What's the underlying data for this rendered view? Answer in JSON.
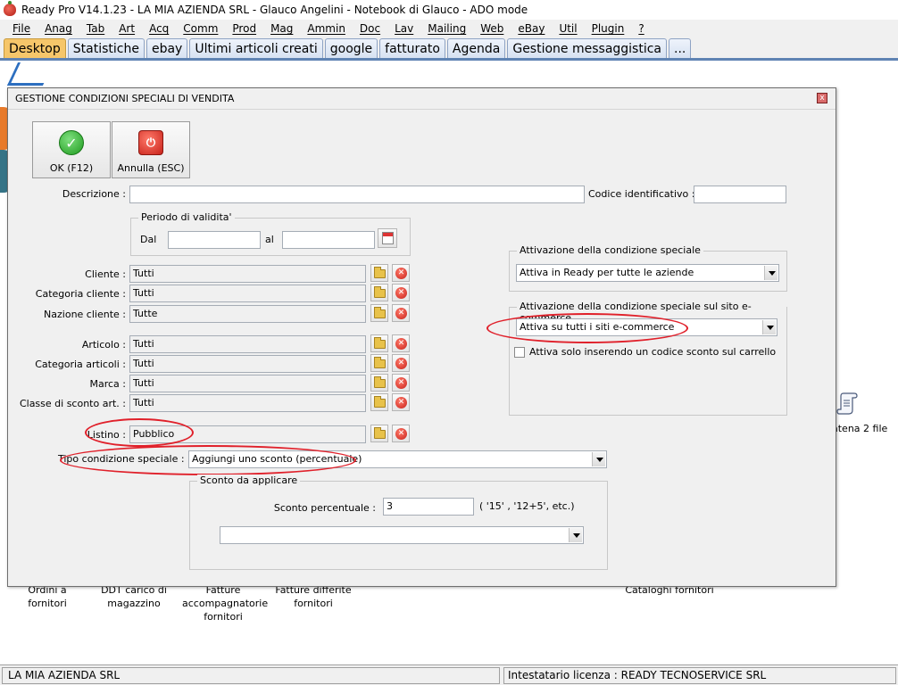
{
  "window": {
    "title": "Ready Pro V14.1.23 - LA MIA AZIENDA SRL - Glauco Angelini - Notebook di Glauco - ADO mode"
  },
  "menu": [
    "File",
    "Anag",
    "Tab",
    "Art",
    "Acq",
    "Comm",
    "Prod",
    "Mag",
    "Ammin",
    "Doc",
    "Lav",
    "Mailing",
    "Web",
    "eBay",
    "Util",
    "Plugin",
    "?"
  ],
  "tabs": [
    "Desktop",
    "Statistiche",
    "ebay",
    "Ultimi articoli creati",
    "google",
    "fatturato",
    "Agenda",
    "Gestione messaggistica",
    "..."
  ],
  "desktop": {
    "labels": {
      "ordini": "Ordini a fornitori",
      "ddt": "DDT carico di magazzino",
      "fatture_acc": "Fatture accompagnatorie fornitori",
      "fatture_diff": "Fatture differite fornitori",
      "cataloghi": "Cataloghi fornitori",
      "catena": "atena 2 file"
    }
  },
  "dialog": {
    "title": "GESTIONE CONDIZIONI SPECIALI DI VENDITA",
    "close": "x",
    "ok_label": "OK (F12)",
    "cancel_label": "Annulla (ESC)",
    "descrizione_label": "Descrizione :",
    "descrizione_value": "",
    "codice_label": "Codice identificativo :",
    "codice_value": "",
    "periodo": {
      "title": "Periodo di validita'",
      "dal_label": "Dal",
      "al_label": "al",
      "dal_value": "",
      "al_value": ""
    },
    "cliente": [
      {
        "label": "Cliente :",
        "value": "Tutti"
      },
      {
        "label": "Categoria cliente :",
        "value": "Tutti"
      },
      {
        "label": "Nazione cliente :",
        "value": "Tutte"
      }
    ],
    "articolo": [
      {
        "label": "Articolo :",
        "value": "Tutti"
      },
      {
        "label": "Categoria articoli :",
        "value": "Tutti"
      },
      {
        "label": "Marca :",
        "value": "Tutti"
      },
      {
        "label": "Classe di sconto art. :",
        "value": "Tutti"
      }
    ],
    "listino": {
      "label": "Listino :",
      "value": "Pubblico"
    },
    "tipo": {
      "label": "Tipo condizione speciale :",
      "value": "Aggiungi uno sconto (percentuale)"
    },
    "sconto": {
      "title": "Sconto da applicare",
      "label": "Sconto percentuale :",
      "value": "3",
      "hint": "( '15' ,  '12+5', etc.)",
      "combo_value": ""
    },
    "attivazione": {
      "title": "Attivazione della condizione speciale",
      "value": "Attiva in Ready per tutte le aziende"
    },
    "ecommerce": {
      "title": "Attivazione della condizione speciale sul sito e-commerce",
      "value": "Attiva su tutti i siti e-commerce",
      "checkbox_label": "Attiva solo inserendo un codice sconto sul carrello"
    }
  },
  "status": {
    "left": "LA MIA AZIENDA SRL",
    "right": "Intestatario licenza : READY TECNOSERVICE SRL"
  },
  "colors": {
    "highlight": "#e0202a",
    "tab_active": "#f6c66a",
    "tab_border": "#5f83b3"
  }
}
